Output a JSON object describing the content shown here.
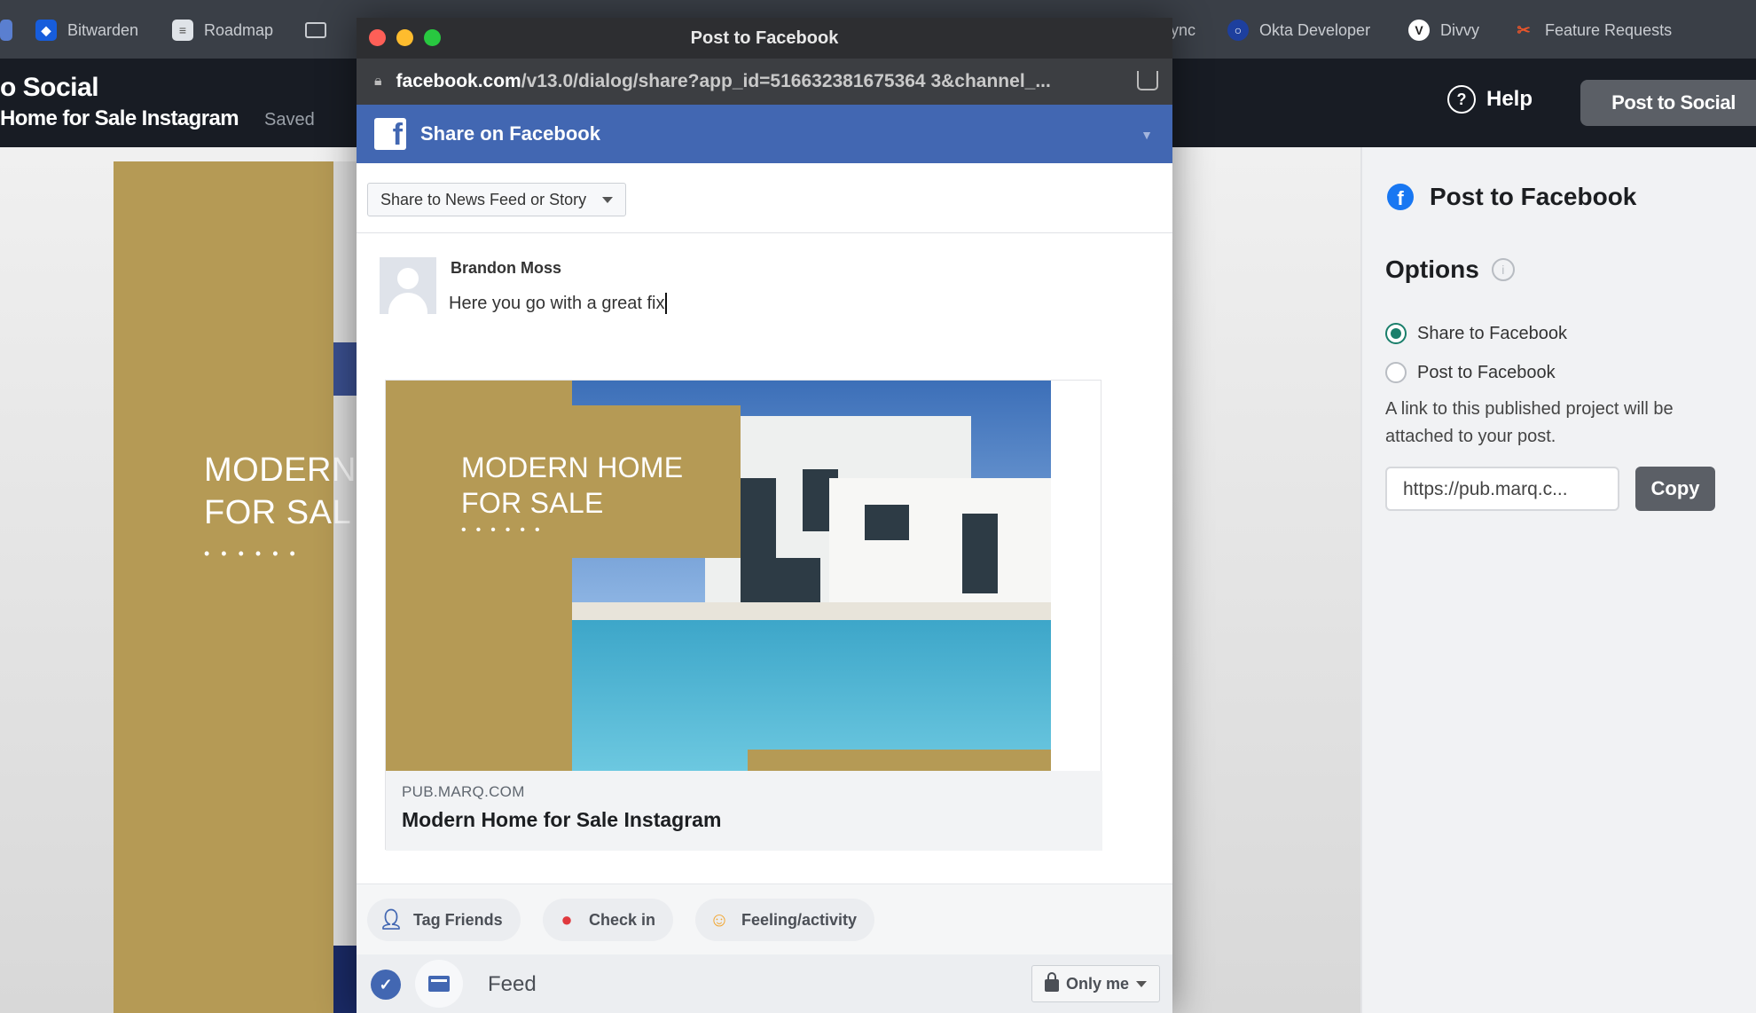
{
  "browser": {
    "bookmarks": [
      {
        "label": "Bitwarden",
        "icon": "shield-icon"
      },
      {
        "label": "Roadmap",
        "icon": "roadmap-icon"
      },
      {
        "label": "ync",
        "icon": ""
      },
      {
        "label": "Okta Developer",
        "icon": "okta-icon"
      },
      {
        "label": "Divvy",
        "icon": "divvy-icon"
      },
      {
        "label": "Feature Requests",
        "icon": "feature-requests-icon"
      }
    ]
  },
  "app": {
    "title": "o Social",
    "document_name": "Home for Sale Instagram",
    "save_status": "Saved",
    "help_label": "Help",
    "post_button_label": "Post to Social"
  },
  "design": {
    "heading": "MODERN\nFOR SAL",
    "dots": "••••••",
    "accent_color": "#b59a55"
  },
  "popup": {
    "window_title": "Post to Facebook",
    "url_host": "facebook.com",
    "url_path": "/v13.0/dialog/share?app_id=516632381675364 3&channel_...",
    "header_title": "Share on Facebook",
    "share_target": "Share to News Feed or Story",
    "author": "Brandon Moss",
    "post_text": "Here you go with a great fix",
    "preview": {
      "image_title": "MODERN HOME\nFOR SALE",
      "dots": "••••••",
      "domain": "PUB.MARQ.COM",
      "name": "Modern Home for Sale Instagram"
    },
    "actions": [
      {
        "label": "Tag Friends",
        "icon": "tag-friends-icon"
      },
      {
        "label": "Check in",
        "icon": "location-pin-icon"
      },
      {
        "label": "Feeling/activity",
        "icon": "smiley-icon"
      }
    ],
    "feed_label": "Feed",
    "audience": "Only me",
    "brand_color": "#4267b2"
  },
  "panel": {
    "title": "Post to Facebook",
    "options_heading": "Options",
    "options": [
      {
        "label": "Share to Facebook",
        "selected": true
      },
      {
        "label": "Post to Facebook",
        "selected": false
      }
    ],
    "note": "A link to this published project will be attached to your post.",
    "link_value": "https://pub.marq.c...",
    "copy_label": "Copy"
  }
}
